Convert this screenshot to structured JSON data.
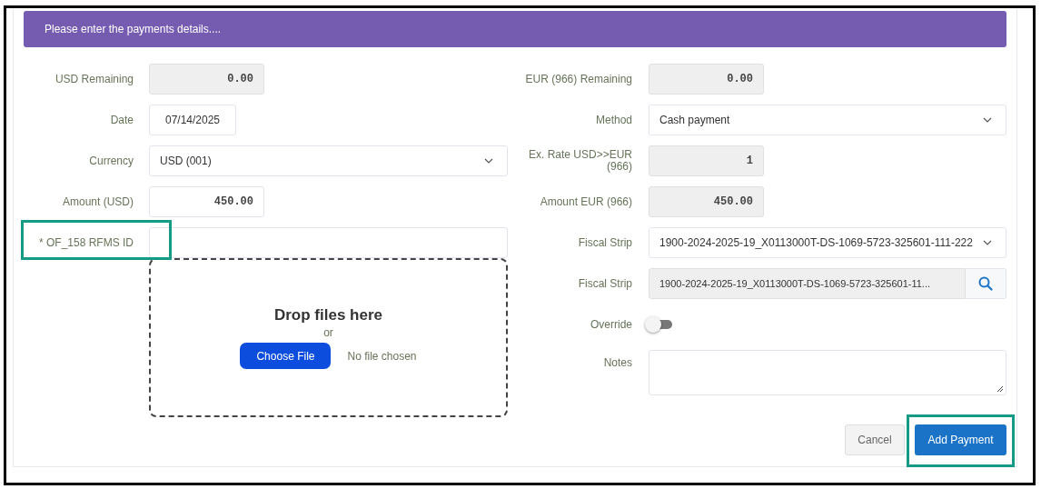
{
  "header": {
    "text": "Please enter the payments details...."
  },
  "left_fields": [
    {
      "label": "USD Remaining",
      "kind": "number",
      "readonly": true,
      "value": "0.00"
    },
    {
      "label": "Date",
      "kind": "date",
      "value": "07/14/2025"
    },
    {
      "label": "Currency",
      "kind": "select",
      "value": "USD (001)"
    },
    {
      "label": "Amount (USD)",
      "kind": "number",
      "readonly": false,
      "value": "450.00"
    },
    {
      "label": "* OF_158 RFMS ID",
      "kind": "text",
      "highlighted": true
    }
  ],
  "dropzone": {
    "title": "Drop files here",
    "or": "or",
    "button": "Choose File",
    "status": "No file chosen"
  },
  "right_fields": [
    {
      "label": "EUR (966) Remaining",
      "kind": "number",
      "readonly": true,
      "value": "0.00"
    },
    {
      "label": "Method",
      "kind": "select",
      "value": "Cash payment"
    },
    {
      "label": "Ex. Rate USD>>EUR (966)",
      "kind": "number",
      "readonly": true,
      "value": "1"
    },
    {
      "label": "Amount EUR (966)",
      "kind": "number",
      "readonly": true,
      "value": "450.00"
    },
    {
      "label": "Fiscal Strip",
      "kind": "select",
      "value": "1900-2024-2025-19_X0113000T-DS-1069-5723-325601-111-222"
    },
    {
      "label": "Fiscal Strip",
      "kind": "search",
      "value": "1900-2024-2025-19_X0113000T-DS-1069-5723-325601-11..."
    },
    {
      "label": "Override",
      "kind": "toggle",
      "on": false
    },
    {
      "label": "Notes",
      "kind": "textarea"
    }
  ],
  "buttons": [
    {
      "label": "Cancel",
      "kind": "secondary",
      "highlighted": false
    },
    {
      "label": "Add Payment",
      "kind": "primary",
      "highlighted": true
    }
  ]
}
